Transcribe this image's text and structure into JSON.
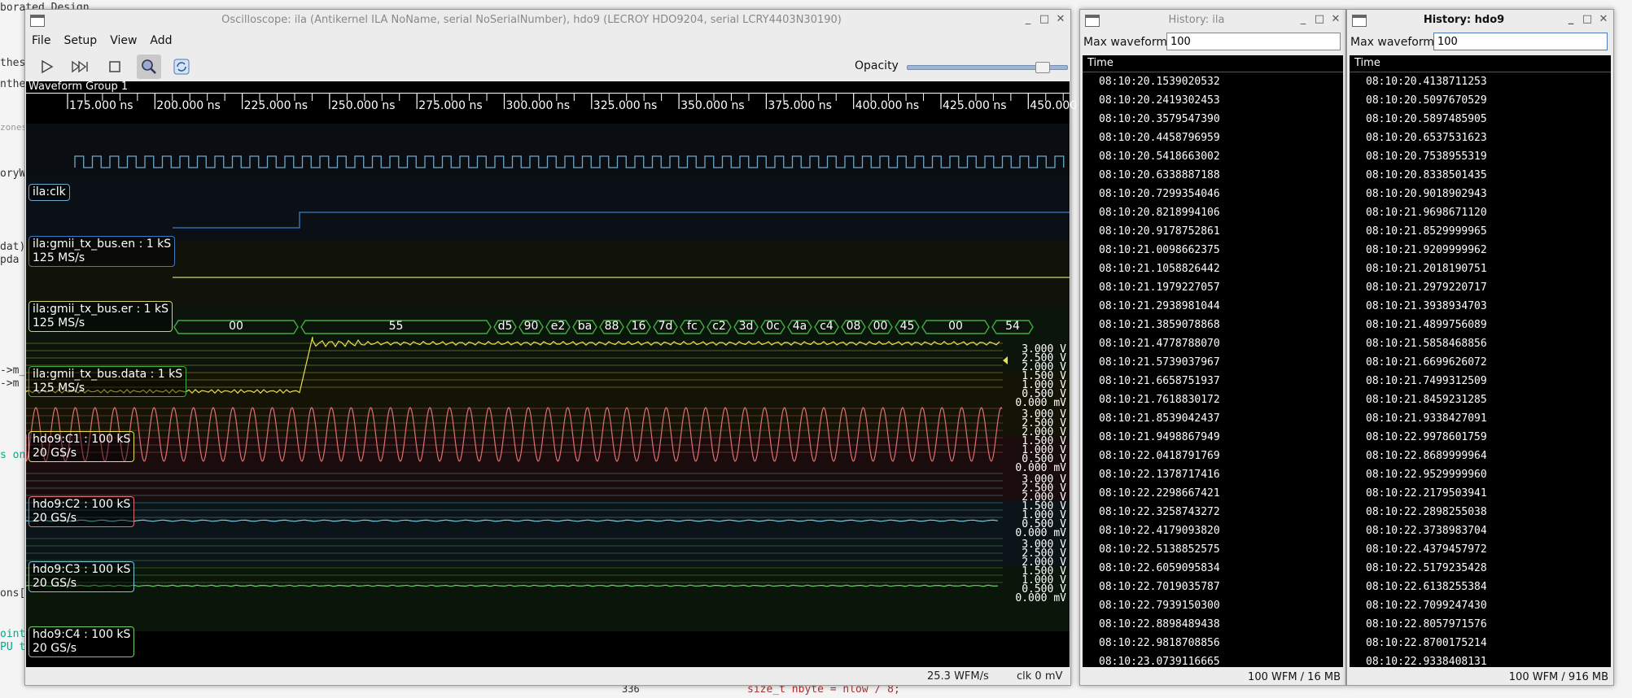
{
  "background": {
    "fragments": [
      "borated Design",
      "thesis",
      "nthes",
      "zones",
      "oryW",
      "dat)",
      "pda",
      "->m_",
      "->m",
      "s on",
      "ons[",
      "oint",
      "PU t",
      "336",
      "size_t nbyte = nlow / 8;"
    ]
  },
  "scope_window": {
    "title": "Oscilloscope: ila (Antikernel ILA NoName, serial NoSerialNumber), hdo9 (LECROY HDO9204, serial LCRY4403N30190)",
    "menu": [
      "File",
      "Setup",
      "View",
      "Add"
    ],
    "toolbar": {
      "opacity_label": "Opacity",
      "opacity_value": 0.84
    },
    "group_label": "Waveform Group 1",
    "time_ticks": [
      "175.000 ns",
      "200.000 ns",
      "225.000 ns",
      "250.000 ns",
      "275.000 ns",
      "300.000 ns",
      "325.000 ns",
      "350.000 ns",
      "375.000 ns",
      "400.000 ns",
      "425.000 ns",
      "450.000 ns"
    ],
    "signals": [
      {
        "name": "ila:clk",
        "rate": "",
        "color": "#6fa8c8"
      },
      {
        "name": "ila:gmii_tx_bus.en : 1 kS",
        "rate": "125 MS/s",
        "color": "#3a7dc6"
      },
      {
        "name": "ila:gmii_tx_bus.er : 1 kS",
        "rate": "125 MS/s",
        "color": "#d0d070"
      },
      {
        "name": "ila:gmii_tx_bus.data : 1 kS",
        "rate": "125 MS/s",
        "color": "#3fae3f"
      },
      {
        "name": "hdo9:C1 : 100 kS",
        "rate": "20 GS/s",
        "color": "#e8e050"
      },
      {
        "name": "hdo9:C2 : 100 kS",
        "rate": "20 GS/s",
        "color": "#e07070"
      },
      {
        "name": "hdo9:C3 : 100 kS",
        "rate": "20 GS/s",
        "color": "#7cc8d8"
      },
      {
        "name": "hdo9:C4 : 100 kS",
        "rate": "20 GS/s",
        "color": "#6fcf6f"
      }
    ],
    "data_bytes": [
      "00",
      "55",
      "d5",
      "90",
      "e2",
      "ba",
      "88",
      "16",
      "7d",
      "fc",
      "c2",
      "3d",
      "0c",
      "4a",
      "c4",
      "08",
      "00",
      "45",
      "00",
      "54"
    ],
    "y_scale": [
      "3.000 V",
      "2.500 V",
      "2.000 V",
      "1.500 V",
      "1.000 V",
      "0.500 V",
      "0.000 mV"
    ],
    "status": {
      "wfm_rate": "25.3 WFM/s",
      "trigger": "clk 0 mV"
    }
  },
  "history_ila": {
    "title": "History: ila",
    "max_label": "Max waveforms",
    "max_value": "100",
    "col_header": "Time",
    "rows": [
      "08:10:20.1539020532",
      "08:10:20.2419302453",
      "08:10:20.3579547390",
      "08:10:20.4458796959",
      "08:10:20.5418663002",
      "08:10:20.6338887188",
      "08:10:20.7299354046",
      "08:10:20.8218994106",
      "08:10:20.9178752861",
      "08:10:21.0098662375",
      "08:10:21.1058826442",
      "08:10:21.1979227057",
      "08:10:21.2938981044",
      "08:10:21.3859078868",
      "08:10:21.4778788070",
      "08:10:21.5739037967",
      "08:10:21.6658751937",
      "08:10:21.7618830172",
      "08:10:21.8539042437",
      "08:10:21.9498867949",
      "08:10:22.0418791769",
      "08:10:22.1378717416",
      "08:10:22.2298667421",
      "08:10:22.3258743272",
      "08:10:22.4179093820",
      "08:10:22.5138852575",
      "08:10:22.6059095834",
      "08:10:22.7019035787",
      "08:10:22.7939150300",
      "08:10:22.8898489438",
      "08:10:22.9818708856",
      "08:10:23.0739116665"
    ],
    "footer": "100 WFM / 16 MB"
  },
  "history_hdo9": {
    "title": "History: hdo9",
    "max_label": "Max waveforms",
    "max_value": "100",
    "col_header": "Time",
    "rows": [
      "08:10:20.4138711253",
      "08:10:20.5097670529",
      "08:10:20.5897485905",
      "08:10:20.6537531623",
      "08:10:20.7538955319",
      "08:10:20.8338501435",
      "08:10:20.9018902943",
      "08:10:21.9698671120",
      "08:10:21.8529999965",
      "08:10:21.9209999962",
      "08:10:21.2018190751",
      "08:10:21.2979220717",
      "08:10:21.3938934703",
      "08:10:21.4899756089",
      "08:10:21.5858468856",
      "08:10:21.6699626072",
      "08:10:21.7499312509",
      "08:10:21.8459231285",
      "08:10:21.9338427091",
      "08:10:22.9978601759",
      "08:10:22.8689999964",
      "08:10:22.9529999960",
      "08:10:22.2179503941",
      "08:10:22.2898255038",
      "08:10:22.3738983704",
      "08:10:22.4379457972",
      "08:10:22.5179235428",
      "08:10:22.6138255384",
      "08:10:22.7099247430",
      "08:10:22.8057971576",
      "08:10:22.8700175214",
      "08:10:22.9338408131"
    ],
    "footer": "100 WFM / 916 MB"
  }
}
